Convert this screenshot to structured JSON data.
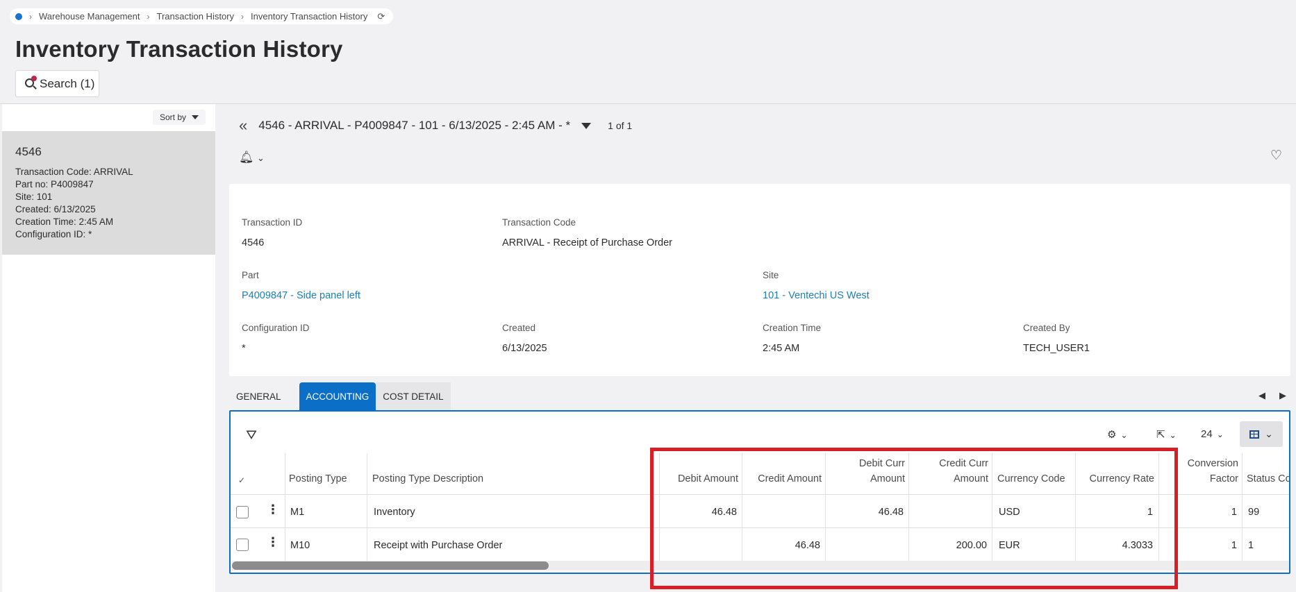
{
  "breadcrumb": {
    "items": [
      "Warehouse Management",
      "Transaction History",
      "Inventory Transaction History"
    ]
  },
  "page": {
    "title": "Inventory Transaction History",
    "search_label": "Search (1)"
  },
  "left_panel": {
    "sort_label": "Sort by",
    "record": {
      "id": "4546",
      "lines": [
        "Transaction Code:  ARRIVAL",
        "Part no:  P4009847",
        "Site:  101",
        "Created:  6/13/2025",
        "Creation Time:  2:45 AM",
        "Configuration ID:  *"
      ]
    }
  },
  "record_header": {
    "title": "4546 - ARRIVAL - P4009847 - 101 - 6/13/2025 - 2:45 AM - *",
    "count": "1 of 1"
  },
  "details": {
    "transaction_id": {
      "label": "Transaction ID",
      "value": "4546"
    },
    "transaction_code": {
      "label": "Transaction Code",
      "value": "ARRIVAL - Receipt of Purchase Order"
    },
    "part": {
      "label": "Part",
      "value": "P4009847 - Side panel left"
    },
    "site": {
      "label": "Site",
      "value": "101 - Ventechi US West"
    },
    "configuration_id": {
      "label": "Configuration ID",
      "value": "*"
    },
    "created": {
      "label": "Created",
      "value": "6/13/2025"
    },
    "creation_time": {
      "label": "Creation Time",
      "value": "2:45 AM"
    },
    "created_by": {
      "label": "Created By",
      "value": "TECH_USER1"
    }
  },
  "tabs": [
    "GENERAL",
    "ACCOUNTING",
    "COST DETAIL"
  ],
  "active_tab": "ACCOUNTING",
  "grid": {
    "page_size": "24",
    "columns": {
      "posting_type": "Posting Type",
      "posting_type_desc": "Posting Type Description",
      "debit_amount": "Debit Amount",
      "credit_amount": "Credit Amount",
      "debit_curr_1": "Debit Curr",
      "debit_curr_2": "Amount",
      "credit_curr_1": "Credit Curr",
      "credit_curr_2": "Amount",
      "currency_code": "Currency Code",
      "currency_rate": "Currency Rate",
      "conversion_1": "Conversion",
      "conversion_2": "Factor",
      "status": "Status Co"
    },
    "rows": [
      {
        "posting_type": "M1",
        "desc": "Inventory",
        "debit": "46.48",
        "credit": "",
        "debit_curr": "46.48",
        "credit_curr": "",
        "currency": "USD",
        "rate": "1",
        "conversion": "1",
        "status": "99"
      },
      {
        "posting_type": "M10",
        "desc": "Receipt with Purchase Order",
        "debit": "",
        "credit": "46.48",
        "debit_curr": "",
        "credit_curr": "200.00",
        "currency": "EUR",
        "rate": "4.3033",
        "conversion": "1",
        "status": "1"
      }
    ]
  },
  "colors": {
    "accent": "#0b6fc7",
    "link": "#1a7fb8",
    "highlight": "#d81f26"
  }
}
